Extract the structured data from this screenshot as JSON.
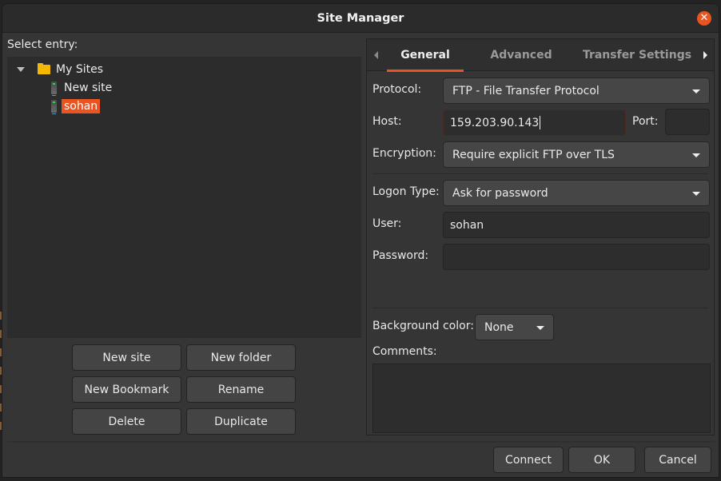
{
  "window": {
    "title": "Site Manager",
    "close_icon": "close-icon"
  },
  "left_panel": {
    "select_entry_label": "Select entry:",
    "tree": {
      "root": {
        "label": "My Sites",
        "icon": "folder-icon",
        "expanded": true
      },
      "children": [
        {
          "label": "New site",
          "icon": "server-icon",
          "selected": false
        },
        {
          "label": "sohan",
          "icon": "server-icon",
          "selected": true
        }
      ]
    },
    "buttons": {
      "new_site": "New site",
      "new_folder": "New folder",
      "new_bookmark": "New Bookmark",
      "rename": "Rename",
      "delete": "Delete",
      "duplicate": "Duplicate"
    }
  },
  "tabs": [
    {
      "label": "General",
      "active": true
    },
    {
      "label": "Advanced",
      "active": false
    },
    {
      "label": "Transfer Settings",
      "active": false
    }
  ],
  "general": {
    "protocol_label": "Protocol:",
    "protocol_value": "FTP - File Transfer Protocol",
    "host_label": "Host:",
    "host_value": "159.203.90.143",
    "port_label": "Port:",
    "port_value": "",
    "encryption_label": "Encryption:",
    "encryption_value": "Require explicit FTP over TLS",
    "logon_type_label": "Logon Type:",
    "logon_type_value": "Ask for password",
    "user_label": "User:",
    "user_value": "sohan",
    "password_label": "Password:",
    "password_value": "",
    "background_color_label": "Background color:",
    "background_color_value": "None",
    "comments_label": "Comments:",
    "comments_value": ""
  },
  "footer": {
    "connect": "Connect",
    "ok": "OK",
    "cancel": "Cancel"
  },
  "colors": {
    "accent": "#e95420",
    "folder": "#f5b800",
    "window_bg": "#353535",
    "titlebar_bg": "#2b2b2b"
  }
}
